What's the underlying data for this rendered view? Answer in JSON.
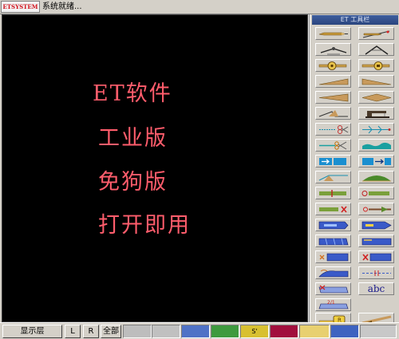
{
  "header": {
    "logo_text": "ETSYSTEM",
    "status_text": "系统就绪..."
  },
  "canvas": {
    "lines": [
      "ET软件",
      "工业版",
      "免狗版",
      "打开即用"
    ],
    "text_color": "#ff5d6c",
    "background": "#000000"
  },
  "palette": {
    "title": "ET 工具栏",
    "tools": [
      {
        "icon": "pencil-icon"
      },
      {
        "icon": "angle-pencil-icon"
      },
      {
        "icon": "compass-icon"
      },
      {
        "icon": "compass-open-icon"
      },
      {
        "icon": "tape-measure-icon"
      },
      {
        "icon": "tape-measure-alt-icon"
      },
      {
        "icon": "blade-taper-icon"
      },
      {
        "icon": "blade-taper-alt-icon"
      },
      {
        "icon": "double-wedge-icon"
      },
      {
        "icon": "double-wedge-alt-icon"
      },
      {
        "icon": "notch-cut-icon"
      },
      {
        "icon": "sewing-machine-icon"
      },
      {
        "icon": "scissors-icon"
      },
      {
        "icon": "arrow-split-icon"
      },
      {
        "icon": "scissors-alt-icon"
      },
      {
        "icon": "teal-wave-icon"
      },
      {
        "icon": "move-right-icon"
      },
      {
        "icon": "move-left-icon"
      },
      {
        "icon": "fold-line-icon"
      },
      {
        "icon": "green-mound-icon"
      },
      {
        "icon": "bar-insert-icon"
      },
      {
        "icon": "bar-delete-icon"
      },
      {
        "icon": "bar-rotate-icon"
      },
      {
        "icon": "pin-line-icon"
      },
      {
        "icon": "panel-blue-icon"
      },
      {
        "icon": "panel-blue-alt-icon"
      },
      {
        "icon": "panel-pleat-icon"
      },
      {
        "icon": "panel-pleat-alt-icon"
      },
      {
        "icon": "panel-cut-icon"
      },
      {
        "icon": "panel-cut-alt-icon"
      },
      {
        "icon": "sleeve-icon"
      },
      {
        "icon": "dash-line-icon"
      },
      {
        "icon": "pocket-icon"
      },
      {
        "icon": "arc-label-icon"
      },
      {
        "icon": "measure-arc-icon"
      },
      {
        "icon": "tape-roll-icon"
      },
      {
        "icon": "ruler-end-icon"
      }
    ],
    "abc_text": "abc",
    "arc_label": "2/1"
  },
  "bottombar": {
    "layer_label": "显示层",
    "l_label": "L",
    "r_label": "R",
    "all_label": "全部",
    "swatches": [
      {
        "color": "#bdbdbd",
        "label": ""
      },
      {
        "color": "#c0c0c0",
        "label": ""
      },
      {
        "color": "#4f72c6",
        "label": ""
      },
      {
        "color": "#3e9a3e",
        "label": ""
      },
      {
        "color": "#d8c030",
        "label": "S'"
      },
      {
        "color": "#a10f3d",
        "label": ""
      },
      {
        "color": "#e8d070",
        "label": ""
      },
      {
        "color": "#3e63c0",
        "label": ""
      },
      {
        "color": "#c8c8c8",
        "label": ""
      }
    ]
  }
}
